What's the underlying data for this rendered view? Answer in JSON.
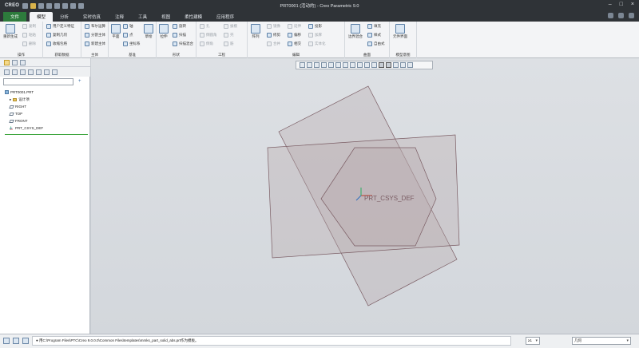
{
  "app": {
    "logo": "CREO",
    "title": "PRT0001 (活动的) - Creo Parametric 9.0",
    "window_controls": [
      "–",
      "□",
      "×"
    ]
  },
  "tabs": [
    {
      "label": "文件",
      "state": "file"
    },
    {
      "label": "模型",
      "state": "active"
    },
    {
      "label": "分析",
      "state": ""
    },
    {
      "label": "实时仿真",
      "state": ""
    },
    {
      "label": "注释",
      "state": ""
    },
    {
      "label": "工具",
      "state": ""
    },
    {
      "label": "视图",
      "state": ""
    },
    {
      "label": "柔性建模",
      "state": ""
    },
    {
      "label": "应用程序",
      "state": ""
    }
  ],
  "ribbon": {
    "groups": {
      "operations": "操作",
      "get_data": "获取数据",
      "body": "主体",
      "datum": "基准",
      "shapes": "形状",
      "engineering": "工程",
      "editing": "编辑",
      "surfaces": "曲面",
      "model_intent": "模型意图"
    },
    "items": {
      "regenerate": "重新生成",
      "copy": "复制",
      "paste": "粘贴",
      "delete": "删除",
      "user_defined_feature": "用户定义特征",
      "copy_geometry": "复制几何",
      "shrinkwrap": "收缩包络",
      "boolean": "布尔运算",
      "split_body": "分割主体",
      "new_body": "新建主体",
      "plane": "平面",
      "axis": "轴",
      "point": "点",
      "csys": "坐标系",
      "curve": "草绘",
      "extrude": "拉伸",
      "revolve": "旋转",
      "sweep": "扫描",
      "swept_blend": "扫描混合",
      "hole": "孔",
      "round": "倒圆角",
      "chamfer": "倒角",
      "draft": "拔模",
      "shell": "壳",
      "rib": "筋",
      "pattern": "阵列",
      "mirror": "镜像",
      "trim": "修剪",
      "merge": "合并",
      "intersect": "相交",
      "extend": "延伸",
      "offset": "偏移",
      "thicken": "加厚",
      "project": "投影",
      "solidify": "实体化",
      "boundary_blend": "边界混合",
      "fill": "填充",
      "style": "样式",
      "freestyle": "自由式",
      "component_interface": "元件界面"
    }
  },
  "left_panel": {
    "filter_placeholder": "",
    "tree": [
      {
        "label": "PRT0001.PRT",
        "kind": "part",
        "level": 0
      },
      {
        "label": "设计项",
        "kind": "folder",
        "level": 1
      },
      {
        "label": "RIGHT",
        "kind": "plane",
        "level": 1
      },
      {
        "label": "TOP",
        "kind": "plane",
        "level": 1
      },
      {
        "label": "FRONT",
        "kind": "plane",
        "level": 1
      },
      {
        "label": "PRT_CSYS_DEF",
        "kind": "csys",
        "level": 1
      }
    ]
  },
  "canvas": {
    "csys_label": "PRT_CSYS_DEF",
    "plane_fill": "#b8a8ad",
    "plane_stroke": "#7a5c63"
  },
  "status": {
    "message": "● 用C:\\Program Files\\PTC\\Creo 9.0.0.0\\Common Files\\templates\\mmks_part_solid_abs.prt作为模板。",
    "selection_count": "≥1",
    "filter_value": "几何"
  },
  "colors": {
    "titlebar": "#2f3337",
    "file_tab": "#2d7b3c",
    "ribbon": "#f3f4f6"
  }
}
